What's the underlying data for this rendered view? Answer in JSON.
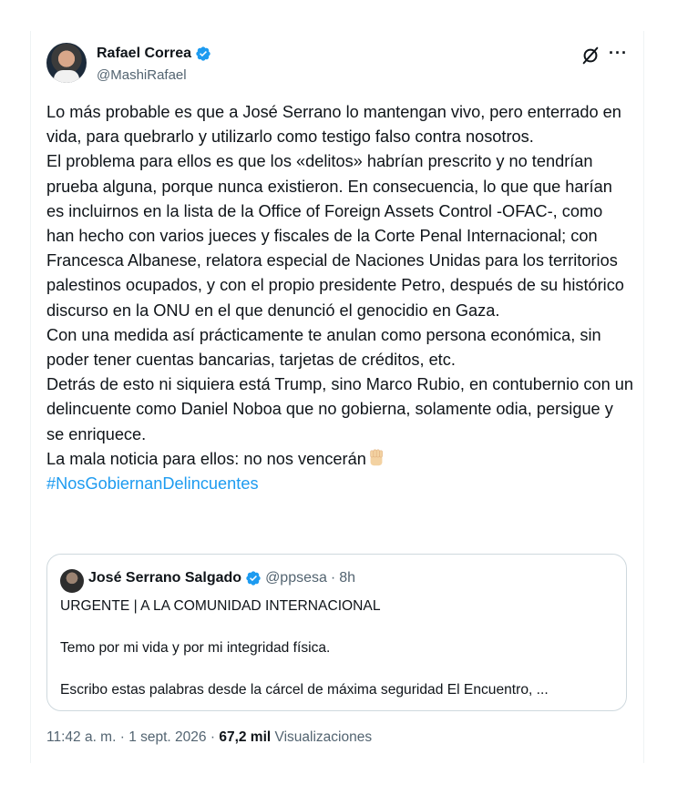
{
  "author": {
    "name": "Rafael Correa",
    "handle": "@MashiRafael",
    "verified_icon": "verified-badge-icon"
  },
  "header_actions": {
    "grok_icon": "grok-icon",
    "more_label": "···"
  },
  "tweet": {
    "paragraphs": [
      "Lo más probable es que a José Serrano lo mantengan vivo, pero enterrado en vida, para quebrarlo y utilizarlo como testigo falso contra nosotros.",
      "El problema para ellos es que los «delitos» habrían prescrito y no tendrían prueba alguna, porque nunca existieron. En consecuencia, lo que que harían es incluirnos en la lista de la Office of Foreign Assets Control -OFAC-, como han hecho con varios jueces y fiscales de la Corte Penal Internacional; con Francesca Albanese, relatora especial de Naciones Unidas para  los territorios palestinos ocupados, y con el propio presidente Petro, después de su histórico discurso en la ONU en el que denunció el genocidio en Gaza.",
      "Con una medida así prácticamente te anulan como persona económica, sin poder tener cuentas bancarias, tarjetas de créditos, etc.",
      "Detrás de esto ni siquiera está Trump, sino Marco Rubio, en contubernio con un delincuente como Daniel Noboa que no gobierna, solamente odia, persigue y se enriquece."
    ],
    "last_line": "La mala noticia para ellos: no nos vencerán",
    "emoji": "raised-fist-emoji",
    "hashtag": "#NosGobiernanDelincuentes"
  },
  "quote": {
    "name": "José Serrano Salgado",
    "handle": "@ppsesa",
    "separator": "·",
    "time": "8h",
    "lines": [
      "URGENTE | A LA COMUNIDAD INTERNACIONAL",
      "Temo por mi vida y por mi integridad física.",
      "Escribo estas palabras desde la cárcel de máxima seguridad El Encuentro, ..."
    ]
  },
  "footer": {
    "time": "11:42 a. m.",
    "sep1": "·",
    "date": "1 sept. 2026",
    "sep2": "·",
    "views_count": "67,2 mil",
    "views_label": "Visualizaciones"
  },
  "colors": {
    "accent": "#1d9bf0",
    "text": "#0f1419",
    "muted": "#536471",
    "border": "#cfd9de"
  }
}
